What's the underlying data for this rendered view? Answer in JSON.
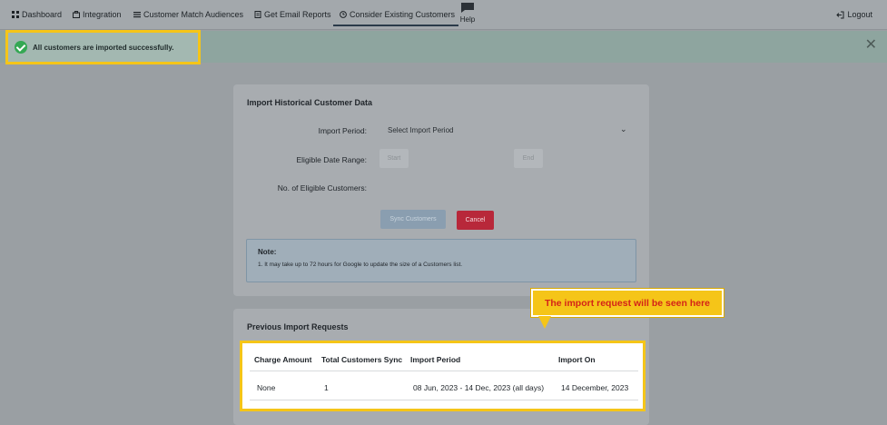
{
  "nav": {
    "items": [
      {
        "label": "Dashboard",
        "icon": "grid-icon"
      },
      {
        "label": "Integration",
        "icon": "briefcase-icon"
      },
      {
        "label": "Customer Match Audiences",
        "icon": "list-icon"
      },
      {
        "label": "Get Email Reports",
        "icon": "document-icon"
      },
      {
        "label": "Consider Existing Customers",
        "icon": "clock-icon"
      }
    ],
    "active": "Consider Existing Customers",
    "help_label": "Help",
    "logout_label": "Logout"
  },
  "toast": {
    "message": "All customers are imported successfully."
  },
  "import_form": {
    "title": "Import Historical Customer Data",
    "import_period_label": "Import Period:",
    "import_period_value": "Select Import Period",
    "eligible_date_range_label": "Eligible Date Range:",
    "start_placeholder": "Start",
    "end_placeholder": "End",
    "eligible_customers_label": "No. of Eligible Customers:",
    "sync_button": "Sync Customers",
    "cancel_button": "Cancel"
  },
  "note": {
    "title": "Note:",
    "items": [
      "1. It may take up to 72 hours for Google to update the size of a Customers list."
    ]
  },
  "callout": {
    "text": "The import request will be seen here"
  },
  "previous_requests": {
    "title": "Previous Import Requests",
    "columns": [
      "Charge Amount",
      "Total Customers Sync",
      "Import Period",
      "Import On"
    ],
    "rows": [
      [
        "None",
        "1",
        "08 Jun, 2023 - 14 Dec, 2023 (all days)",
        "14 December, 2023"
      ]
    ]
  },
  "colors": {
    "highlight": "#f5c518",
    "callout_text": "#d42318",
    "cancel": "#b8283a",
    "success": "#34a853"
  }
}
